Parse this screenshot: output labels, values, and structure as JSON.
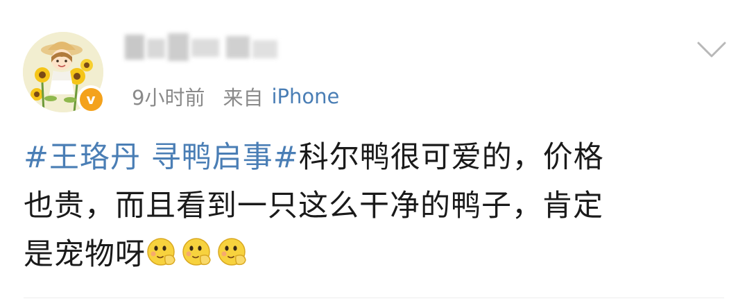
{
  "post": {
    "time": "9小时前",
    "source_prefix": "来自",
    "source_device": "iPhone",
    "topic": "#王珞丹 寻鸭启事#",
    "text_line1": "科尔鸭很可爱的，价格",
    "text_line2": "也贵，而且看到一只这么干净的鸭子，肯定",
    "text_line3": "是宠物呀",
    "emojis": [
      "smirk-emoji",
      "smirk-emoji",
      "smirk-emoji"
    ]
  },
  "colors": {
    "link_blue": "#4a7eb5",
    "meta_gray": "#8a8a8a",
    "text_black": "#1a1a1a",
    "verified_orange": "#f4a21c"
  }
}
